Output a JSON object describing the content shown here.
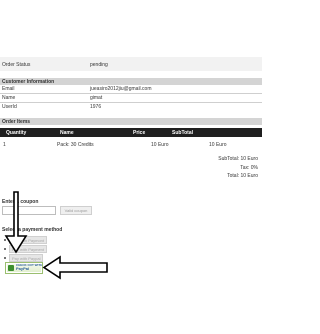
{
  "order": {
    "status_label": "Order Status",
    "status_value": "pending"
  },
  "customer": {
    "section_title": "Customer Information",
    "fields": [
      {
        "label": "Email",
        "value": "jueasiro2012jiu@gmail.com"
      },
      {
        "label": "Name",
        "value": "gimat"
      },
      {
        "label": "UserId",
        "value": "1976"
      }
    ]
  },
  "items": {
    "section_title": "Order Items",
    "columns": [
      "Quantity",
      "Name",
      "Price",
      "SubTotal"
    ],
    "rows": [
      {
        "quantity": "1",
        "name": "Pack: 30 Credits",
        "price": "10 Euro",
        "subtotal": "10 Euro"
      }
    ]
  },
  "totals": {
    "subtotal": "SubTotal: 10 Euro",
    "tax": "Tax: 0%",
    "total": "Total: 10 Euro"
  },
  "coupon": {
    "title": "Enter a coupon",
    "input_value": "",
    "button_label": "Valid coupon"
  },
  "payment": {
    "title": "Select a payment method",
    "methods": [
      "Pay with Paymont",
      "Pay with Payment",
      "Pay with Paypal"
    ],
    "logo_text_1": "CHECK OUT WITH",
    "logo_text_2": "PayPal"
  }
}
